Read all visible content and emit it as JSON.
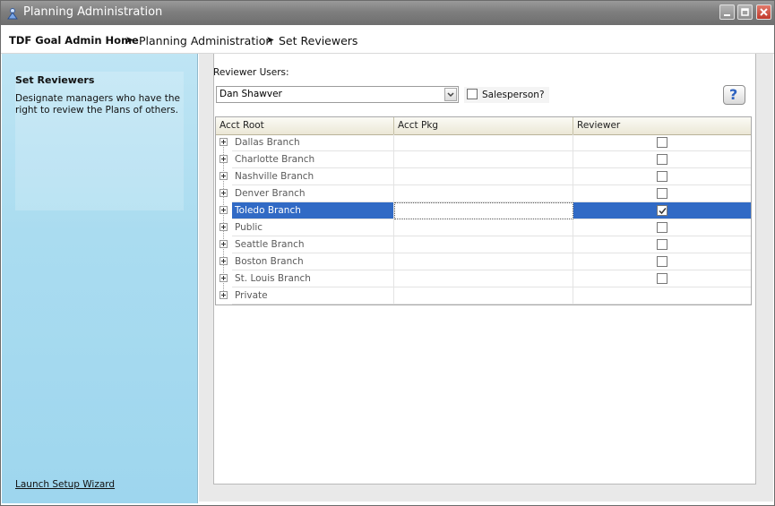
{
  "window": {
    "title": "Planning Administration"
  },
  "breadcrumb": {
    "home": "TDF Goal Admin Home",
    "separator": "➤",
    "level1": "Planning Administration",
    "current": "Set Reviewers"
  },
  "sidebar": {
    "title": "Set Reviewers",
    "description": "Designate managers who have the right to review the Plans of others.",
    "link": "Launch Setup Wizard"
  },
  "form": {
    "reviewer_label": "Reviewer Users:",
    "reviewer_value": "Dan Shawver",
    "salesperson_label": "Salesperson?",
    "salesperson_checked": false,
    "help_label": "?"
  },
  "grid": {
    "columns": [
      "Acct Root",
      "Acct Pkg",
      "Reviewer"
    ],
    "rows": [
      {
        "acct_root": "Dallas Branch",
        "acct_pkg": "",
        "reviewer": false,
        "has_checkbox": true,
        "selected": false
      },
      {
        "acct_root": "Charlotte Branch",
        "acct_pkg": "",
        "reviewer": false,
        "has_checkbox": true,
        "selected": false
      },
      {
        "acct_root": "Nashville Branch",
        "acct_pkg": "",
        "reviewer": false,
        "has_checkbox": true,
        "selected": false
      },
      {
        "acct_root": "Denver Branch",
        "acct_pkg": "",
        "reviewer": false,
        "has_checkbox": true,
        "selected": false
      },
      {
        "acct_root": "Toledo Branch",
        "acct_pkg": "",
        "reviewer": true,
        "has_checkbox": true,
        "selected": true
      },
      {
        "acct_root": "Public",
        "acct_pkg": "",
        "reviewer": false,
        "has_checkbox": true,
        "selected": false
      },
      {
        "acct_root": "Seattle Branch",
        "acct_pkg": "",
        "reviewer": false,
        "has_checkbox": true,
        "selected": false
      },
      {
        "acct_root": "Boston Branch",
        "acct_pkg": "",
        "reviewer": false,
        "has_checkbox": true,
        "selected": false
      },
      {
        "acct_root": "St. Louis Branch",
        "acct_pkg": "",
        "reviewer": false,
        "has_checkbox": true,
        "selected": false
      },
      {
        "acct_root": "Private",
        "acct_pkg": "",
        "reviewer": false,
        "has_checkbox": false,
        "selected": false
      }
    ]
  },
  "colors": {
    "selection": "#316ac5",
    "sidebar": "#aadcf0",
    "titlebar": "#7e7e7e"
  },
  "icons": {
    "app": "planning-app-icon",
    "minimize": "minimize-icon",
    "maximize": "maximize-icon",
    "close": "close-icon",
    "help": "help-icon",
    "dropdown": "chevron-down-icon",
    "expander": "plus-expander-icon"
  }
}
